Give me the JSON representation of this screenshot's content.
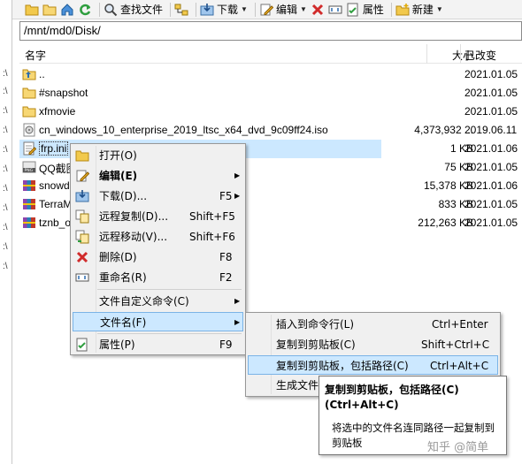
{
  "toolbar": {
    "find_label": "查找文件",
    "download_label": "下载",
    "edit_label": "编辑",
    "properties_label": "属性",
    "new_label": "新建"
  },
  "path": "/mnt/md0/Disk/",
  "columns": {
    "name": "名字",
    "size": "大小",
    "modified": "已改变"
  },
  "files": [
    {
      "name": "..",
      "size": "",
      "date": "2021.01.05",
      "icon": "up-folder-icon"
    },
    {
      "name": "#snapshot",
      "size": "",
      "date": "2021.01.05",
      "icon": "folder-icon"
    },
    {
      "name": "xfmovie",
      "size": "",
      "date": "2021.01.05",
      "icon": "folder-icon"
    },
    {
      "name": "cn_windows_10_enterprise_2019_ltsc_x64_dvd_9c09ff24.iso",
      "size": "4,373,932 ...",
      "date": "2019.06.11",
      "icon": "disc-image-icon"
    },
    {
      "name": "frp.ini",
      "size": "1 KB",
      "date": "2021.01.06",
      "icon": "ini-file-icon"
    },
    {
      "name": "QQ截图",
      "size": "75 KB",
      "date": "2021.01.05",
      "icon": "png-image-icon"
    },
    {
      "name": "snowd",
      "size": "15,378 KB",
      "date": "2021.01.06",
      "icon": "archive-icon"
    },
    {
      "name": "TerraM",
      "size": "833 KB",
      "date": "2021.01.05",
      "icon": "archive-icon"
    },
    {
      "name": "tznb_o",
      "size": "212,263 KB",
      "date": "2021.01.05",
      "icon": "archive-icon"
    }
  ],
  "context_menu": {
    "open": "打开(O)",
    "edit": "编辑(E)",
    "download": "下载(D)...",
    "download_sc": "F5",
    "remote_copy": "远程复制(D)...",
    "remote_copy_sc": "Shift+F5",
    "remote_move": "远程移动(V)...",
    "remote_move_sc": "Shift+F6",
    "delete": "删除(D)",
    "delete_sc": "F8",
    "rename": "重命名(R)",
    "rename_sc": "F2",
    "custom_commands": "文件自定义命令(C)",
    "file_names": "文件名(F)",
    "properties": "属性(P)",
    "properties_sc": "F9"
  },
  "submenu": {
    "insert_cmd": "插入到命令行(L)",
    "insert_cmd_sc": "Ctrl+Enter",
    "copy_clipboard": "复制到剪贴板(C)",
    "copy_clipboard_sc": "Shift+Ctrl+C",
    "copy_with_path": "复制到剪贴板，包括路径(C)",
    "copy_with_path_sc": "Ctrl+Alt+C",
    "generate_file": "生成文件"
  },
  "tooltip": {
    "title": "复制到剪贴板，包括路径(C)\n(Ctrl+Alt+C)",
    "body": "将选中的文件名连同路径一起复制到剪贴板"
  },
  "watermark": "知乎 @简单"
}
